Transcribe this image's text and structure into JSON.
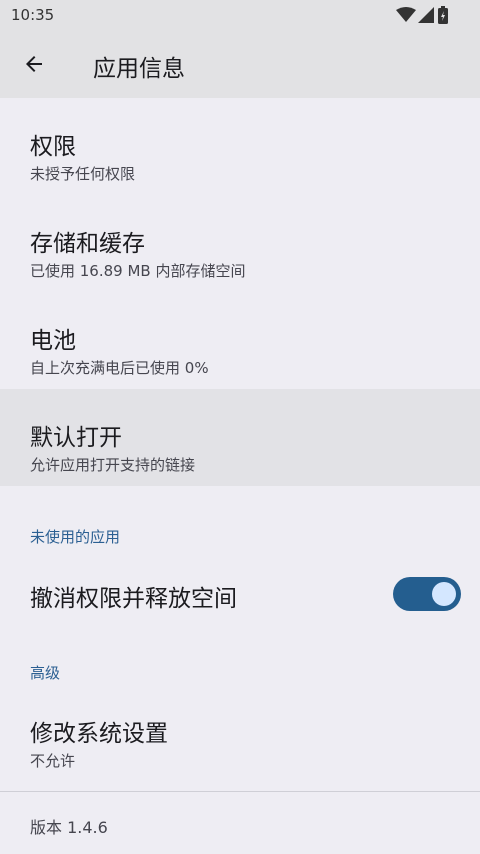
{
  "status_bar": {
    "time": "10:35"
  },
  "app_bar": {
    "title": "应用信息"
  },
  "items": [
    {
      "title": "权限",
      "subtitle": "未授予任何权限"
    },
    {
      "title": "存储和缓存",
      "subtitle": "已使用 16.89 MB 内部存储空间"
    },
    {
      "title": "电池",
      "subtitle": "自上次充满电后已使用 0%"
    },
    {
      "title": "默认打开",
      "subtitle": "允许应用打开支持的链接"
    }
  ],
  "unused_section": {
    "header": "未使用的应用",
    "toggle_label": "撤消权限并释放空间",
    "toggle_on": true
  },
  "advanced_section": {
    "header": "高级",
    "item_title": "修改系统设置",
    "item_subtitle": "不允许"
  },
  "footer": {
    "version": "版本 1.4.6"
  },
  "colors": {
    "accent": "#245e8f",
    "section_header": "#2b5f92",
    "background": "#eeedf3"
  }
}
